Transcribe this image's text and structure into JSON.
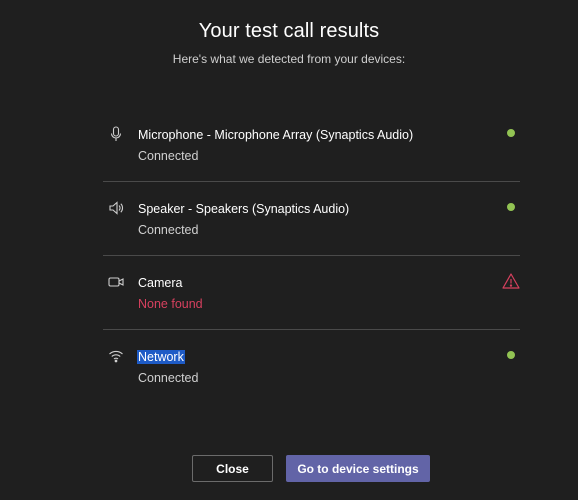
{
  "dialog": {
    "title": "Your test call results",
    "subtitle": "Here's what we detected from your devices:"
  },
  "devices": [
    {
      "icon": "microphone-icon",
      "name": "Microphone - Microphone Array (Synaptics Audio)",
      "status": "Connected",
      "indicator": "ok"
    },
    {
      "icon": "speaker-icon",
      "name": "Speaker - Speakers (Synaptics Audio)",
      "status": "Connected",
      "indicator": "ok"
    },
    {
      "icon": "camera-icon",
      "name": "Camera",
      "status": "None found",
      "indicator": "warning"
    },
    {
      "icon": "wifi-icon",
      "name": "Network",
      "status": "Connected",
      "indicator": "ok"
    }
  ],
  "buttons": {
    "close_label": "Close",
    "settings_label": "Go to device settings"
  },
  "colors": {
    "background": "#1f1f1f",
    "ok": "#92c353",
    "error": "#d6405e",
    "primary": "#6264a7",
    "selection": "#1e5bc6"
  }
}
